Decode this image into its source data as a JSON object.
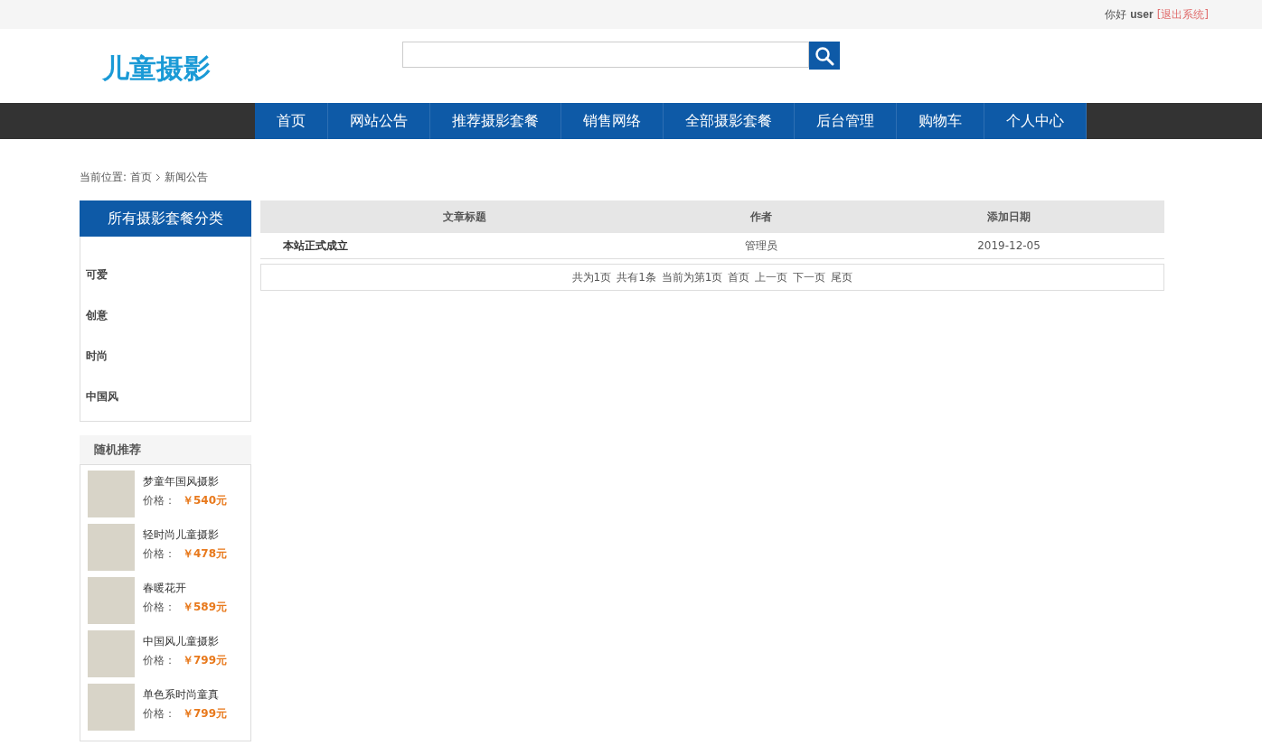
{
  "topbar": {
    "greeting": "你好",
    "username": "user",
    "logout": "[退出系统]"
  },
  "header": {
    "logo": "儿童摄影"
  },
  "nav": [
    "首页",
    "网站公告",
    "推荐摄影套餐",
    "销售网络",
    "全部摄影套餐",
    "后台管理",
    "购物车",
    "个人中心"
  ],
  "breadcrumb": {
    "label": "当前位置:",
    "home": "首页",
    "current": "新闻公告"
  },
  "categories": {
    "title": "所有摄影套餐分类",
    "items": [
      "可爱",
      "创意",
      "时尚",
      "中国风"
    ]
  },
  "recommend": {
    "title": "随机推荐",
    "items": [
      {
        "name": "梦童年国风摄影",
        "price_label": "价格：",
        "price": "￥540元"
      },
      {
        "name": "轻时尚儿童摄影",
        "price_label": "价格：",
        "price": "￥478元"
      },
      {
        "name": "春暖花开",
        "price_label": "价格：",
        "price": "￥589元"
      },
      {
        "name": "中国风儿童摄影",
        "price_label": "价格：",
        "price": "￥799元"
      },
      {
        "name": "单色系时尚童真",
        "price_label": "价格：",
        "price": "￥799元"
      }
    ]
  },
  "table": {
    "columns": [
      "文章标题",
      "作者",
      "添加日期"
    ],
    "rows": [
      [
        "本站正式成立",
        "管理员",
        "2019-12-05"
      ]
    ]
  },
  "pager": [
    "共为1页",
    "共有1条",
    "当前为第1页",
    "首页",
    "上一页",
    "下一页",
    "尾页"
  ]
}
